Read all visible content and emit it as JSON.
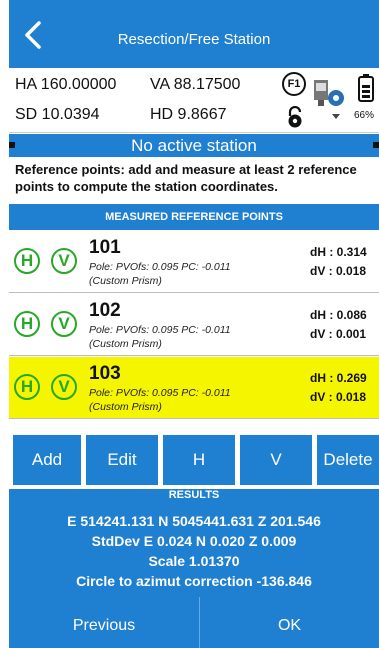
{
  "header": {
    "title": "Resection/Free Station"
  },
  "measurements": {
    "ha": "HA 160.00000",
    "va": "VA 88.17500",
    "sd": "SD 10.0394",
    "hd": "HD 9.8667",
    "f1_label": "F1",
    "battery_pct": "66%"
  },
  "station_status": "No active station",
  "description": "Reference points: add and measure at least 2 reference points to compute the station coordinates.",
  "section_title": "MEASURED REFERENCE POINTS",
  "toggles": {
    "h": "H",
    "v": "V"
  },
  "points": [
    {
      "name": "101",
      "pole": "Pole:  PVOfs: 0.095 PC: -0.011",
      "prism": "(Custom Prism)",
      "dh": "dH : 0.314",
      "dv": "dV : 0.018",
      "selected": false
    },
    {
      "name": "102",
      "pole": "Pole:  PVOfs: 0.095 PC: -0.011",
      "prism": "(Custom Prism)",
      "dh": "dH : 0.086",
      "dv": "dV : 0.001",
      "selected": false
    },
    {
      "name": "103",
      "pole": "Pole:  PVOfs: 0.095 PC: -0.011",
      "prism": "(Custom Prism)",
      "dh": "dH : 0.269",
      "dv": "dV : 0.018",
      "selected": true
    }
  ],
  "actions": {
    "add": "Add",
    "edit": "Edit",
    "h": "H",
    "v": "V",
    "delete": "Delete"
  },
  "results": {
    "title": "RESULTS",
    "coords": "E 514241.131 N 5045441.631 Z 201.546",
    "stddev": "StdDev E 0.024 N 0.020 Z 0.009",
    "scale": "Scale 1.01370",
    "azimuth": "Circle to azimut correction -136.846"
  },
  "nav": {
    "previous": "Previous",
    "ok": "OK"
  },
  "colors": {
    "primary": "#1f7fd0",
    "selected_row": "#f5f500",
    "toggle_green": "#27a829"
  }
}
